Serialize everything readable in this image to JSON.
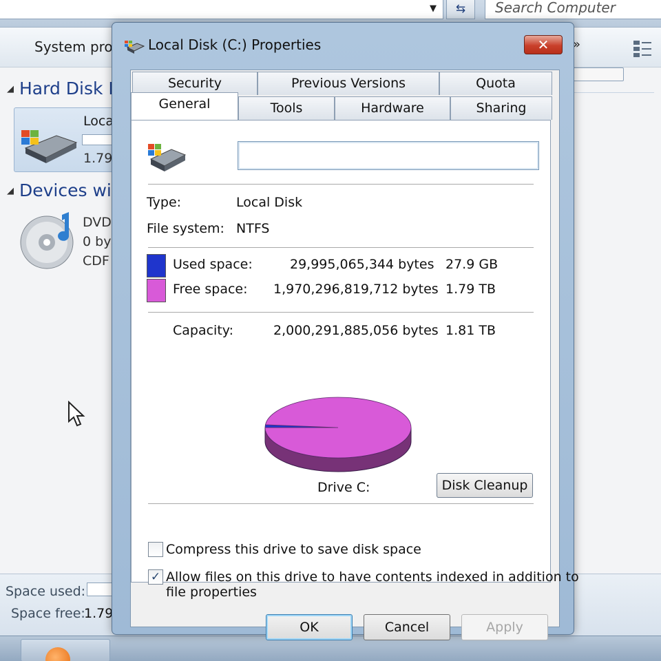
{
  "explorer": {
    "search_placeholder": "Search Computer",
    "toolbar_label": "System prop",
    "group_hard_disk": "Hard Disk I",
    "group_devices": "Devices wit",
    "hdd_tile": {
      "name": "Loca",
      "free": "1.79"
    },
    "dvd": {
      "name": "DVD",
      "size": "0 by",
      "fs": "CDF"
    },
    "details": {
      "space_used_label": "Space used:",
      "space_free_label": "Space free:",
      "space_free_value": "1.79"
    }
  },
  "dialog": {
    "title": "Local Disk (C:) Properties",
    "close_glyph": "✕",
    "tabs_row1": [
      "Security",
      "Previous Versions",
      "Quota"
    ],
    "tabs_row2": [
      "General",
      "Tools",
      "Hardware",
      "Sharing"
    ],
    "active_tab": "General",
    "label_value": "",
    "type_label": "Type:",
    "type_value": "Local Disk",
    "fs_label": "File system:",
    "fs_value": "NTFS",
    "used": {
      "label": "Used space:",
      "bytes": "29,995,065,344 bytes",
      "size": "27.9 GB",
      "color": "#1f35cc"
    },
    "free": {
      "label": "Free space:",
      "bytes": "1,970,296,819,712 bytes",
      "size": "1.79 TB",
      "color": "#d85ad8"
    },
    "capacity": {
      "label": "Capacity:",
      "bytes": "2,000,291,885,056 bytes",
      "size": "1.81 TB"
    },
    "drive_label": "Drive C:",
    "cleanup_button": "Disk Cleanup",
    "compress": {
      "label": "Compress this drive to save disk space",
      "checked": false
    },
    "index": {
      "label_line1": "Allow files on this drive to have contents indexed in addition to",
      "label_line2": "file properties",
      "checked": true
    },
    "check_glyph": "✓",
    "ok_button": "OK",
    "cancel_button": "Cancel",
    "apply_button": "Apply"
  },
  "chart_data": {
    "type": "pie",
    "labels": [
      "Used space",
      "Free space"
    ],
    "values": [
      29995065344,
      1970296819712
    ],
    "colors": [
      "#1f35cc",
      "#d85ad8"
    ]
  }
}
